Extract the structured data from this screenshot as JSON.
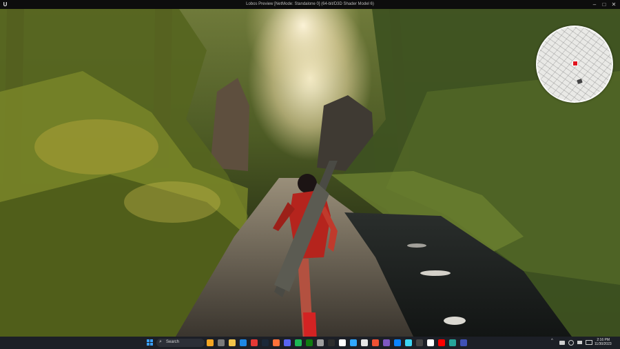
{
  "window": {
    "title": "Lobos Preview [NetMode: Standalone 0] (64-bit/D3D Shader Model 6)",
    "logo_text": "U",
    "controls": {
      "minimize": "–",
      "maximize": "□",
      "close": "✕"
    }
  },
  "minimap": {
    "icon": "compass-map"
  },
  "taskbar": {
    "search_placeholder": "Search",
    "search_icon": "search-icon",
    "pinned_icons": [
      "weather-icon",
      "task-view-icon",
      "explorer-icon",
      "edge-icon",
      "chrome-icon",
      "steam-icon",
      "firefox-icon",
      "discord-icon",
      "spotify-icon",
      "xbox-icon",
      "settings-icon",
      "obs-icon",
      "epic-icon",
      "photoshop-icon",
      "unreal-icon",
      "git-icon",
      "vs-icon",
      "mail-icon",
      "notepad-icon",
      "terminal-icon",
      "notion-icon",
      "adobe-icon",
      "mixer-icon",
      "calendar-icon"
    ],
    "tray": {
      "chevron": "^"
    },
    "clock": {
      "time": "2:16 PM",
      "date": "11/30/2023"
    }
  }
}
